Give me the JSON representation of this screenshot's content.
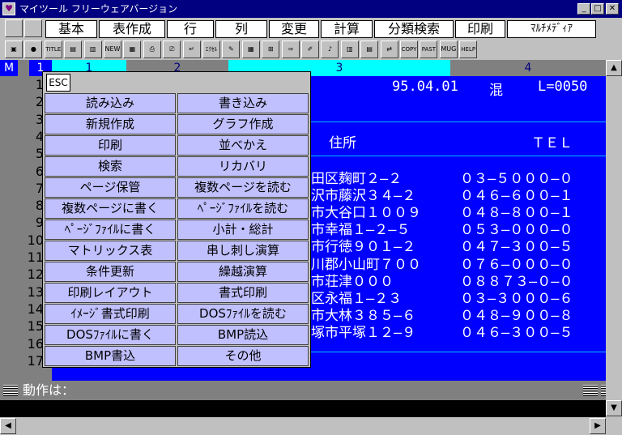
{
  "window": {
    "title": "マイツール フリーウェアバージョン",
    "minimize": "_",
    "maximize": "□",
    "close": "✕"
  },
  "menu_tabs": [
    "基本",
    "表作成",
    "行",
    "列",
    "変更",
    "計算",
    "分類検索",
    "印刷",
    "ﾏﾙﾁﾒﾃﾞｨｱ"
  ],
  "toolbar": {
    "items": [
      {
        "icon": "window-icon",
        "label": "▣"
      },
      {
        "icon": "color-icon",
        "label": "●"
      },
      {
        "icon": "title-icon",
        "label": "TITLE"
      },
      {
        "icon": "copy-window-icon",
        "label": "▤"
      },
      {
        "icon": "frame-icon",
        "label": "▥"
      },
      {
        "icon": "new-icon",
        "label": "NEW"
      },
      {
        "icon": "save-icon",
        "label": "▦"
      },
      {
        "icon": "print-icon",
        "label": "⎙"
      },
      {
        "icon": "print-setup-icon",
        "label": "⎚"
      },
      {
        "icon": "enter-icon",
        "label": "↵"
      },
      {
        "icon": "epage-icon",
        "label": "ｴｸｾﾙﾍﾟｰｼﾞ"
      },
      {
        "icon": "edit-icon",
        "label": "✎"
      },
      {
        "icon": "table-icon",
        "label": "▦"
      },
      {
        "icon": "insert-icon",
        "label": "⊞"
      },
      {
        "icon": "arrow-doc-icon",
        "label": "⇒"
      },
      {
        "icon": "pen-icon",
        "label": "✐"
      },
      {
        "icon": "sound-icon",
        "label": "♪"
      },
      {
        "icon": "book-icon",
        "label": "▥"
      },
      {
        "icon": "note-icon",
        "label": "▤"
      },
      {
        "icon": "swap-icon",
        "label": "⇄"
      },
      {
        "icon": "copy-icon",
        "label": "COPY"
      },
      {
        "icon": "paste-icon",
        "label": "PAST"
      },
      {
        "icon": "mug-icon",
        "label": "MUG"
      },
      {
        "icon": "help-icon",
        "label": "HELP"
      }
    ]
  },
  "columns": {
    "mode": "M",
    "headers": [
      "1",
      "1",
      "2",
      "3",
      "4"
    ]
  },
  "rows": [
    "1",
    "2",
    "3",
    "4",
    "5",
    "6",
    "7",
    "8",
    "9",
    "10",
    "11",
    "12",
    "13",
    "14",
    "15",
    "16",
    "17"
  ],
  "sheet": {
    "date": "95.04.01",
    "mix": "混",
    "length": "L=0050",
    "header_address": "住所",
    "header_tel": "ＴＥＬ",
    "records": [
      {
        "address": "田区麹町２—２",
        "tel": "０３—５０００—０"
      },
      {
        "address": "沢市藤沢３４—２",
        "tel": "０４６—６００—１"
      },
      {
        "address": "市大谷口１００９",
        "tel": "０４８—８００—１"
      },
      {
        "address": "市幸福１—２—５",
        "tel": "０５３—０００—０"
      },
      {
        "address": "市行徳９０１—２",
        "tel": "０４７—３００—５"
      },
      {
        "address": "川郡小山町７００",
        "tel": "０７６—０００—０"
      },
      {
        "address": "市荘津０００",
        "tel": "０８８７３—０—０"
      },
      {
        "address": "区永福１—２３",
        "tel": "０３—３０００—６"
      },
      {
        "address": "市大林３８５—６",
        "tel": "０４８—９００—８"
      },
      {
        "address": "塚市平塚１２—９",
        "tel": "０４６—３００—５"
      }
    ]
  },
  "popup": {
    "esc": "ESC",
    "left": [
      "読み込み",
      "新規作成",
      "印刷",
      "検索",
      "ページ保管",
      "複数ページに書く",
      "ﾍﾟｰｼﾞﾌｧｲﾙに書く",
      "マトリックス表",
      "条件更新",
      "印刷レイアウト",
      "ｲﾒｰｼﾞ書式印刷",
      "DOSﾌｧｲﾙに書く",
      "BMP書込"
    ],
    "right": [
      "書き込み",
      "グラフ作成",
      "並べかえ",
      "リカバリ",
      "複数ページを読む",
      "ﾍﾟｰｼﾞﾌｧｲﾙを読む",
      "小計・総計",
      "串し刺し演算",
      "繰越演算",
      "書式印刷",
      "DOSﾌｧｲﾙを読む",
      "BMP読込",
      "その他"
    ]
  },
  "status": {
    "label": "動作は："
  },
  "scroll": {
    "up": "▲",
    "down": "▼",
    "left": "◀",
    "right": "▶"
  }
}
